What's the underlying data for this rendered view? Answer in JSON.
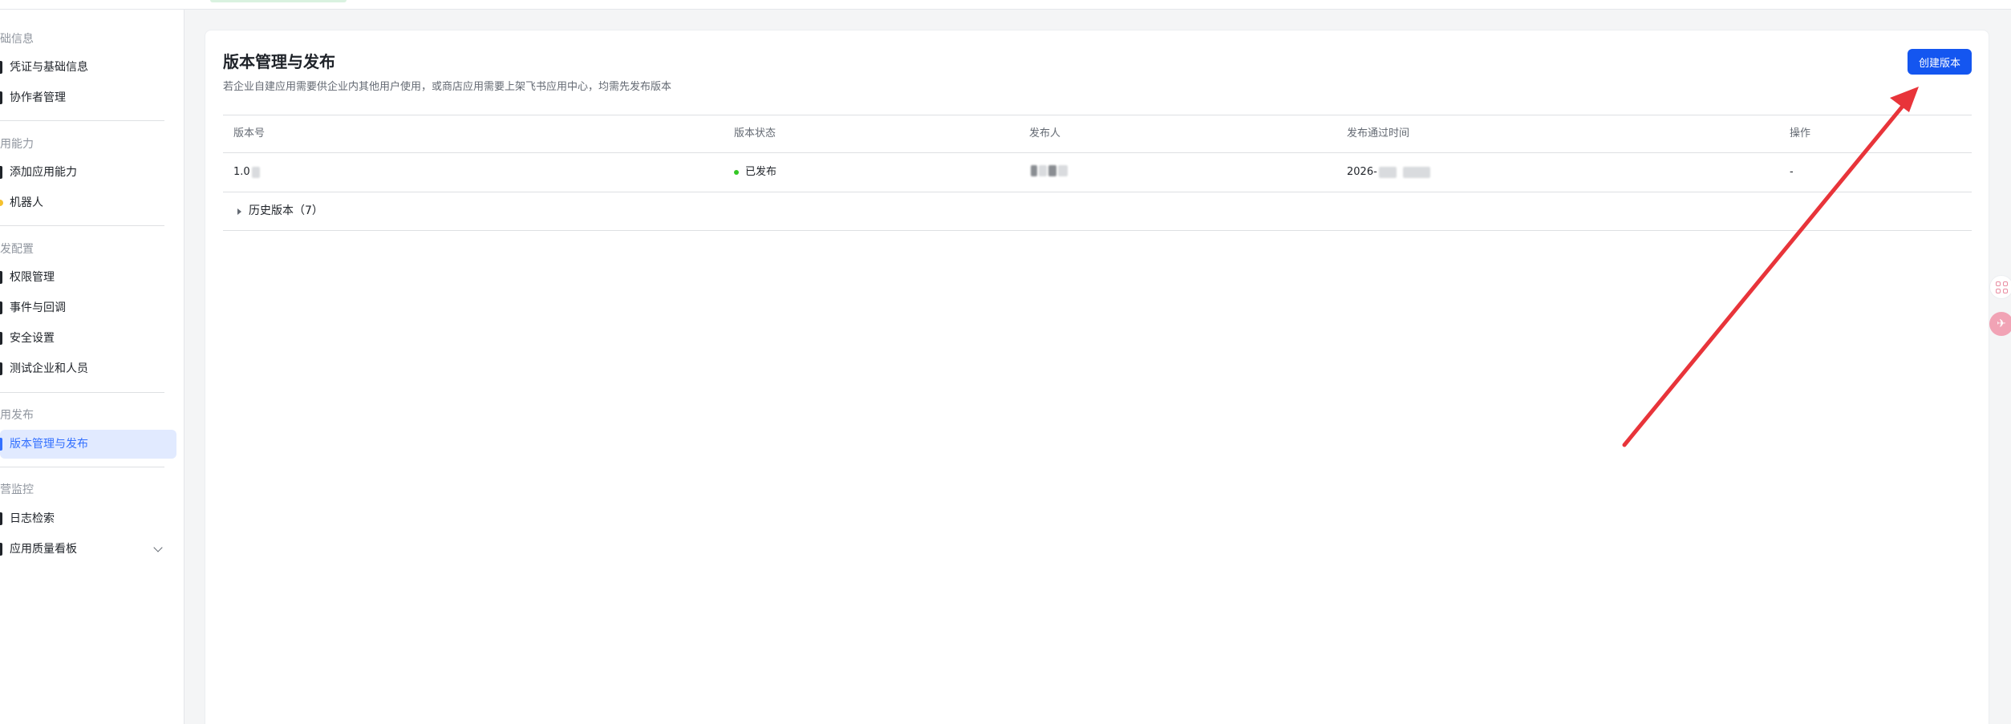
{
  "sidebar": {
    "groups": [
      {
        "title": "础信息",
        "items": [
          {
            "label": "凭证与基础信息"
          },
          {
            "label": "协作者管理"
          }
        ]
      },
      {
        "title": "用能力",
        "items": [
          {
            "label": "添加应用能力"
          },
          {
            "label": "机器人"
          }
        ]
      },
      {
        "title": "发配置",
        "items": [
          {
            "label": "权限管理"
          },
          {
            "label": "事件与回调"
          },
          {
            "label": "安全设置"
          },
          {
            "label": "测试企业和人员"
          }
        ]
      },
      {
        "title": "用发布",
        "items": [
          {
            "label": "版本管理与发布",
            "active": true
          }
        ]
      },
      {
        "title": "营监控",
        "items": [
          {
            "label": "日志检索"
          },
          {
            "label": "应用质量看板",
            "expandable": true
          }
        ]
      }
    ]
  },
  "main": {
    "title": "版本管理与发布",
    "description": "若企业自建应用需要供企业内其他用户使用，或商店应用需要上架飞书应用中心，均需先发布版本",
    "create_button": "创建版本",
    "table": {
      "columns": [
        "版本号",
        "版本状态",
        "发布人",
        "发布通过时间",
        "操作"
      ],
      "rows": [
        {
          "version": "1.0",
          "status": "已发布",
          "publisher": "",
          "approved_time": "2026-",
          "action": "-"
        }
      ],
      "history_label": "历史版本（7）"
    }
  },
  "colors": {
    "primary": "#1456f0",
    "active_bg": "#e1eaff",
    "active_text": "#3370ff",
    "status_published": "#34c724",
    "annotation_arrow": "#e8343a"
  },
  "icons": {
    "float_top": "apps-grid-icon",
    "float_bottom": "translate-icon"
  }
}
